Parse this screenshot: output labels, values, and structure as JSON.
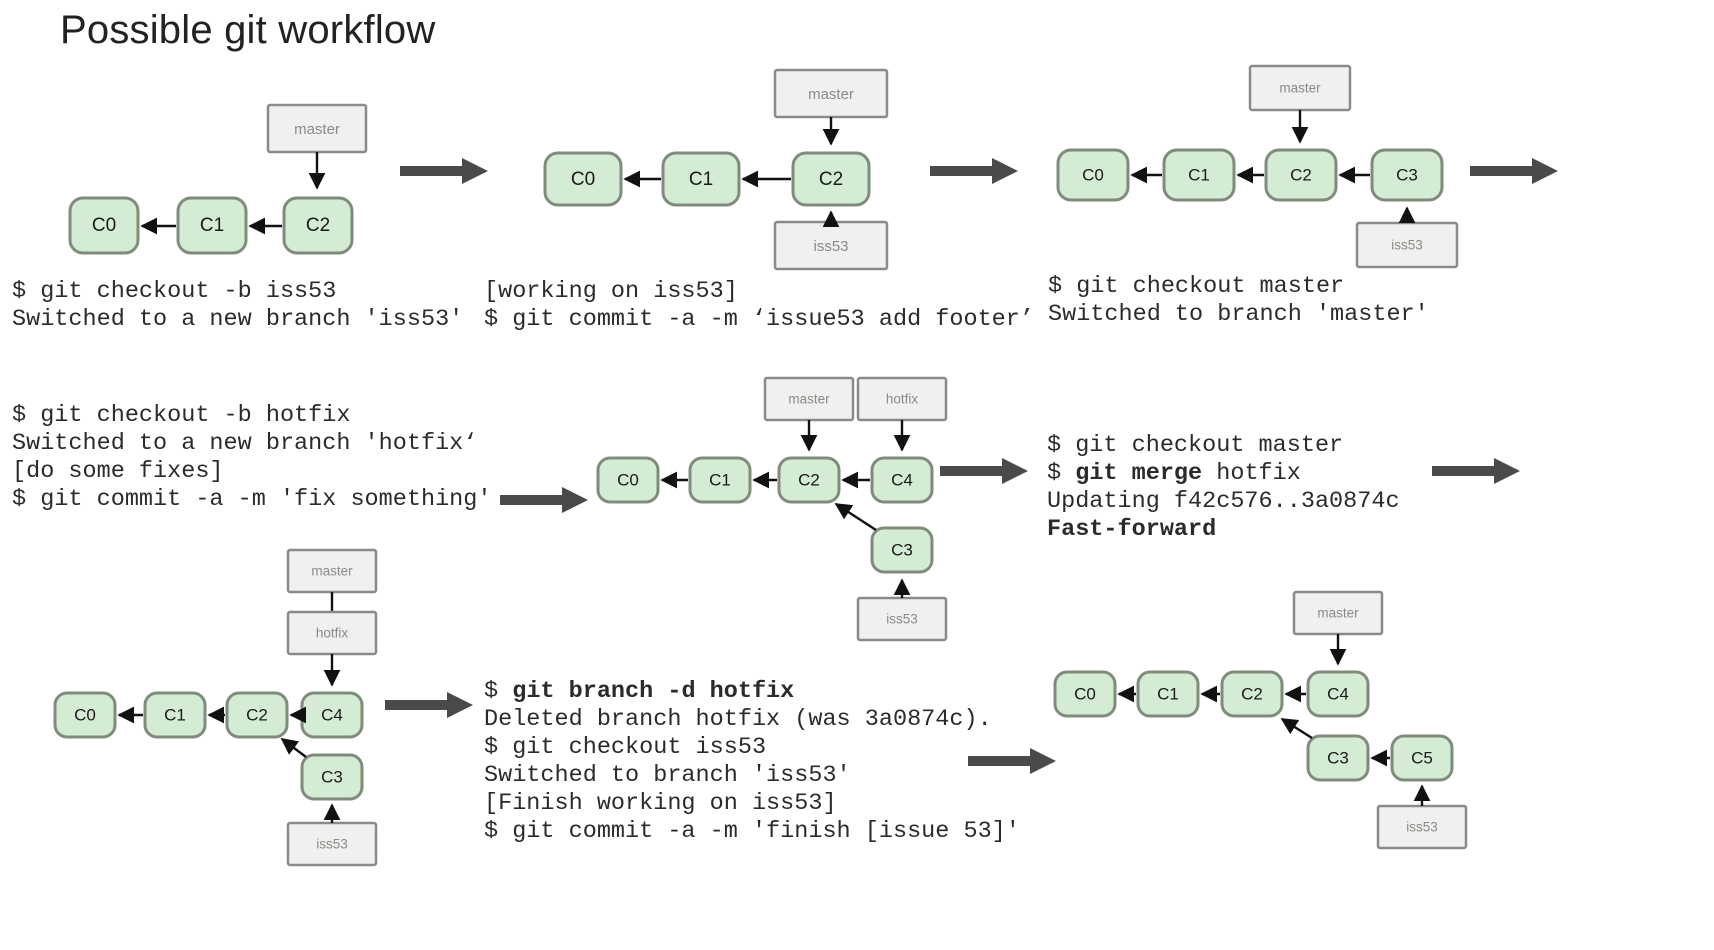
{
  "title": "Possible git workflow",
  "labels": {
    "commit_c0": "C0",
    "commit_c1": "C1",
    "commit_c2": "C2",
    "commit_c3": "C3",
    "commit_c4": "C4",
    "commit_c5": "C5",
    "branch_master": "master",
    "branch_iss53": "iss53",
    "branch_hotfix": "hotfix"
  },
  "steps": [
    {
      "id": "step-1",
      "diagram": {
        "commits": [
          "C0",
          "C1",
          "C2"
        ],
        "branches": [
          {
            "name": "master",
            "on": "C2"
          }
        ]
      },
      "terminal": [
        {
          "text": "$ git checkout -b iss53",
          "bold": false
        },
        {
          "text": "Switched to a new branch 'iss53'",
          "bold": false
        }
      ]
    },
    {
      "id": "step-2",
      "diagram": {
        "commits": [
          "C0",
          "C1",
          "C2"
        ],
        "branches": [
          {
            "name": "master",
            "on": "C2"
          },
          {
            "name": "iss53",
            "on": "C2"
          }
        ]
      },
      "terminal": [
        {
          "text": "[working on iss53]",
          "bold": false
        },
        {
          "text": "$ git commit -a -m ‘issue53 add footer’",
          "bold": false
        }
      ]
    },
    {
      "id": "step-3",
      "diagram": {
        "commits": [
          "C0",
          "C1",
          "C2",
          "C3"
        ],
        "branches": [
          {
            "name": "master",
            "on": "C2"
          },
          {
            "name": "iss53",
            "on": "C3"
          }
        ]
      },
      "terminal": [
        {
          "text": "$ git checkout master",
          "bold": false
        },
        {
          "text": "Switched to branch 'master'",
          "bold": false
        }
      ]
    },
    {
      "id": "step-4",
      "terminal": [
        {
          "text": "$ git checkout -b hotfix",
          "bold": false
        },
        {
          "text": "Switched to a new branch 'hotfix‘",
          "bold": false
        },
        {
          "text": "[do some fixes]",
          "bold": false
        },
        {
          "text": "$ git commit -a -m 'fix something'",
          "bold": false
        }
      ]
    },
    {
      "id": "step-5",
      "diagram": {
        "commits": [
          "C0",
          "C1",
          "C2",
          "C3",
          "C4"
        ],
        "branches": [
          {
            "name": "master",
            "on": "C2"
          },
          {
            "name": "hotfix",
            "on": "C4"
          },
          {
            "name": "iss53",
            "on": "C3"
          }
        ]
      }
    },
    {
      "id": "step-6",
      "terminal": [
        {
          "text": "$ git checkout master",
          "bold": false
        },
        {
          "prefix": "$ ",
          "bold_part": "git merge",
          "suffix": " hotfix",
          "bold": "partial"
        },
        {
          "text": "Updating f42c576..3a0874c",
          "bold": false
        },
        {
          "text": "Fast-forward",
          "bold": true
        }
      ]
    },
    {
      "id": "step-7",
      "diagram": {
        "commits": [
          "C0",
          "C1",
          "C2",
          "C3",
          "C4"
        ],
        "branches": [
          {
            "name": "master",
            "on": "hotfix-stack"
          },
          {
            "name": "hotfix",
            "on": "C4"
          },
          {
            "name": "iss53",
            "on": "C3"
          }
        ]
      }
    },
    {
      "id": "step-8",
      "terminal": [
        {
          "prefix": "$ ",
          "bold_part": "git branch -d hotfix",
          "suffix": "",
          "bold": "partial"
        },
        {
          "text": "Deleted branch hotfix (was 3a0874c).",
          "bold": false
        },
        {
          "text": "$ git checkout iss53",
          "bold": false
        },
        {
          "text": "Switched to branch 'iss53'",
          "bold": false
        },
        {
          "text": "[Finish working on iss53]",
          "bold": false
        },
        {
          "text": "$ git commit -a -m 'finish [issue 53]'",
          "bold": false
        }
      ]
    },
    {
      "id": "step-9",
      "diagram": {
        "commits": [
          "C0",
          "C1",
          "C2",
          "C3",
          "C4",
          "C5"
        ],
        "branches": [
          {
            "name": "master",
            "on": "C4"
          },
          {
            "name": "iss53",
            "on": "C5"
          }
        ]
      }
    }
  ],
  "colors": {
    "commit_fill": "#d5ecd4",
    "commit_stroke": "#7f8c7c",
    "branch_fill": "#f0f0ee",
    "branch_stroke": "#8a8a88",
    "arrow": "#4a4a4a",
    "text": "#2b2b2b",
    "title": "#222222"
  }
}
